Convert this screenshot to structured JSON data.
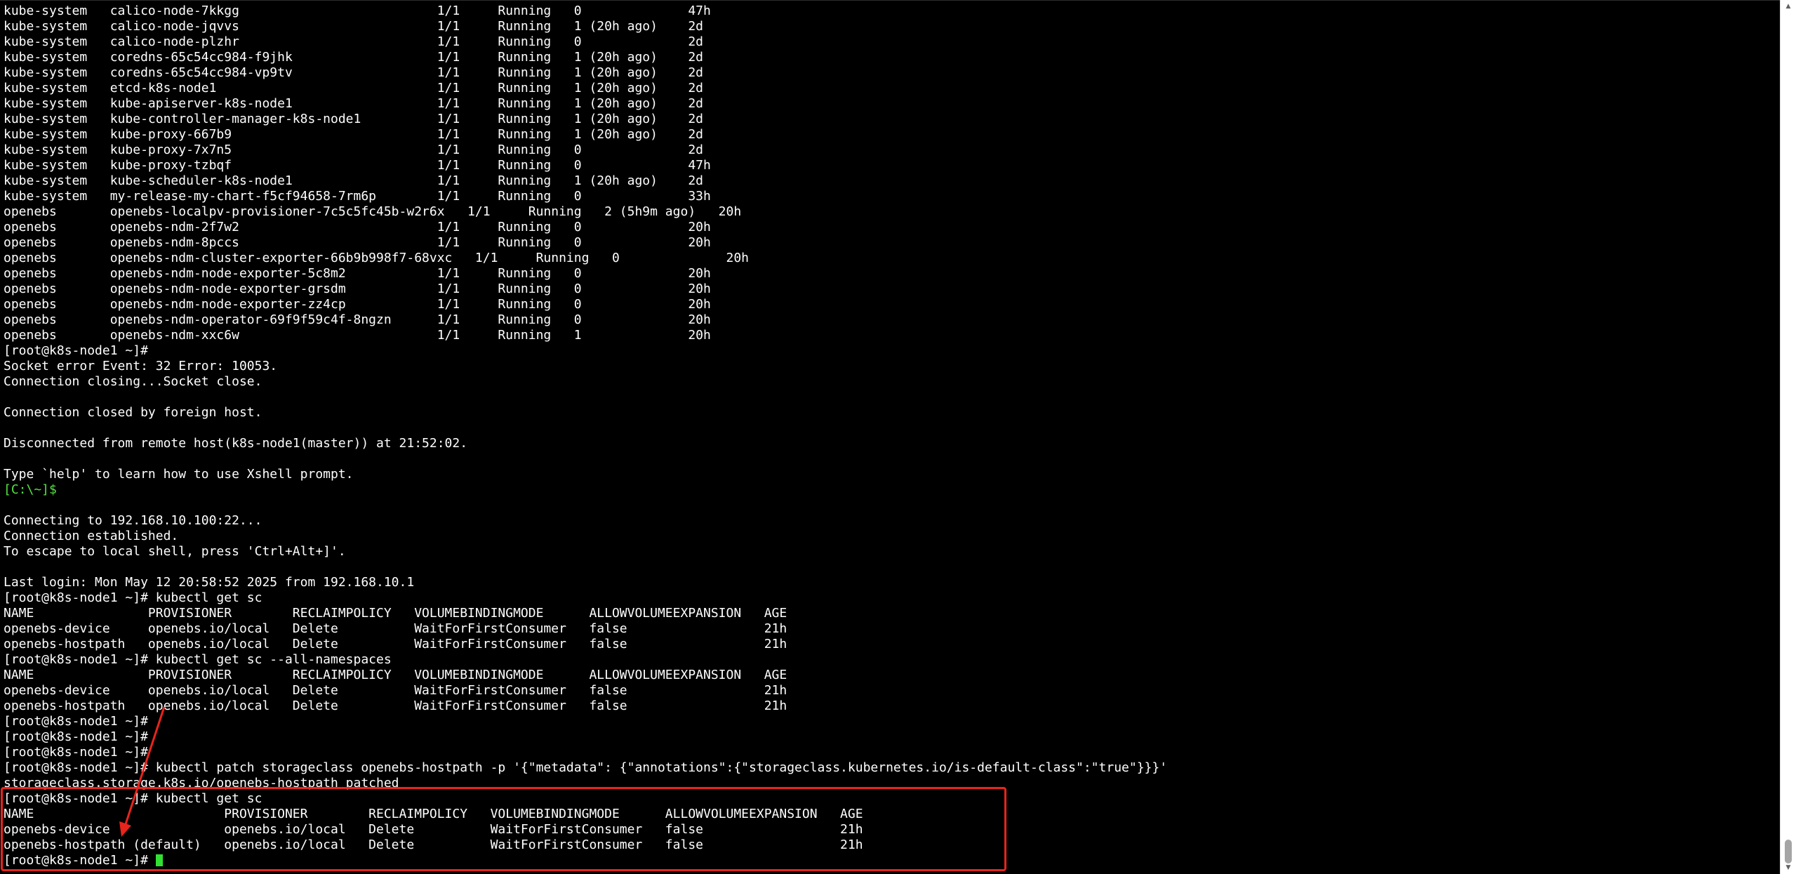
{
  "terminal": {
    "cursor_color": "#32e032",
    "prompt_color": "#54e043",
    "lines": [
      "kube-system   calico-node-7kkgg                          1/1     Running   0              47h",
      "kube-system   calico-node-jqvvs                          1/1     Running   1 (20h ago)    2d",
      "kube-system   calico-node-plzhr                          1/1     Running   0              2d",
      "kube-system   coredns-65c54cc984-f9jhk                   1/1     Running   1 (20h ago)    2d",
      "kube-system   coredns-65c54cc984-vp9tv                   1/1     Running   1 (20h ago)    2d",
      "kube-system   etcd-k8s-node1                             1/1     Running   1 (20h ago)    2d",
      "kube-system   kube-apiserver-k8s-node1                   1/1     Running   1 (20h ago)    2d",
      "kube-system   kube-controller-manager-k8s-node1          1/1     Running   1 (20h ago)    2d",
      "kube-system   kube-proxy-667b9                           1/1     Running   1 (20h ago)    2d",
      "kube-system   kube-proxy-7x7n5                           1/1     Running   0              2d",
      "kube-system   kube-proxy-tzbqf                           1/1     Running   0              47h",
      "kube-system   kube-scheduler-k8s-node1                   1/1     Running   1 (20h ago)    2d",
      "kube-system   my-release-my-chart-f5cf94658-7rm6p        1/1     Running   0              33h",
      "openebs       openebs-localpv-provisioner-7c5c5fc45b-w2r6x   1/1     Running   2 (5h9m ago)   20h",
      "openebs       openebs-ndm-2f7w2                          1/1     Running   0              20h",
      "openebs       openebs-ndm-8pccs                          1/1     Running   0              20h",
      "openebs       openebs-ndm-cluster-exporter-66b9b998f7-68vxc   1/1     Running   0              20h",
      "openebs       openebs-ndm-node-exporter-5c8m2            1/1     Running   0              20h",
      "openebs       openebs-ndm-node-exporter-grsdm            1/1     Running   0              20h",
      "openebs       openebs-ndm-node-exporter-zz4cp            1/1     Running   0              20h",
      "openebs       openebs-ndm-operator-69f9f59c4f-8ngzn      1/1     Running   0              20h",
      "openebs       openebs-ndm-xxc6w                          1/1     Running   1              20h",
      "[root@k8s-node1 ~]#",
      "Socket error Event: 32 Error: 10053.",
      "Connection closing...Socket close.",
      "",
      "Connection closed by foreign host.",
      "",
      "Disconnected from remote host(k8s-node1(master)) at 21:52:02.",
      "",
      "Type `help' to learn how to use Xshell prompt.",
      "[C:\\~]$",
      "",
      "Connecting to 192.168.10.100:22...",
      "Connection established.",
      "To escape to local shell, press 'Ctrl+Alt+]'.",
      "",
      "Last login: Mon May 12 20:58:52 2025 from 192.168.10.1",
      "[root@k8s-node1 ~]# kubectl get sc",
      "NAME               PROVISIONER        RECLAIMPOLICY   VOLUMEBINDINGMODE      ALLOWVOLUMEEXPANSION   AGE",
      "openebs-device     openebs.io/local   Delete          WaitForFirstConsumer   false                  21h",
      "openebs-hostpath   openebs.io/local   Delete          WaitForFirstConsumer   false                  21h",
      "[root@k8s-node1 ~]# kubectl get sc --all-namespaces",
      "NAME               PROVISIONER        RECLAIMPOLICY   VOLUMEBINDINGMODE      ALLOWVOLUMEEXPANSION   AGE",
      "openebs-device     openebs.io/local   Delete          WaitForFirstConsumer   false                  21h",
      "openebs-hostpath   openebs.io/local   Delete          WaitForFirstConsumer   false                  21h",
      "[root@k8s-node1 ~]#",
      "[root@k8s-node1 ~]#",
      "[root@k8s-node1 ~]#",
      "[root@k8s-node1 ~]# kubectl patch storageclass openebs-hostpath -p '{\"metadata\": {\"annotations\":{\"storageclass.kubernetes.io/is-default-class\":\"true\"}}}'",
      "storageclass.storage.k8s.io/openebs-hostpath patched",
      "[root@k8s-node1 ~]# kubectl get sc",
      "NAME                         PROVISIONER        RECLAIMPOLICY   VOLUMEBINDINGMODE      ALLOWVOLUMEEXPANSION   AGE",
      "openebs-device               openebs.io/local   Delete          WaitForFirstConsumer   false                  21h",
      "openebs-hostpath (default)   openebs.io/local   Delete          WaitForFirstConsumer   false                  21h",
      "[root@k8s-node1 ~]# "
    ]
  },
  "annotations": {
    "highlight_color": "#e8241c"
  },
  "scrollbar": {
    "up_icon": "triangle-up-icon",
    "down_icon": "triangle-down-icon"
  }
}
